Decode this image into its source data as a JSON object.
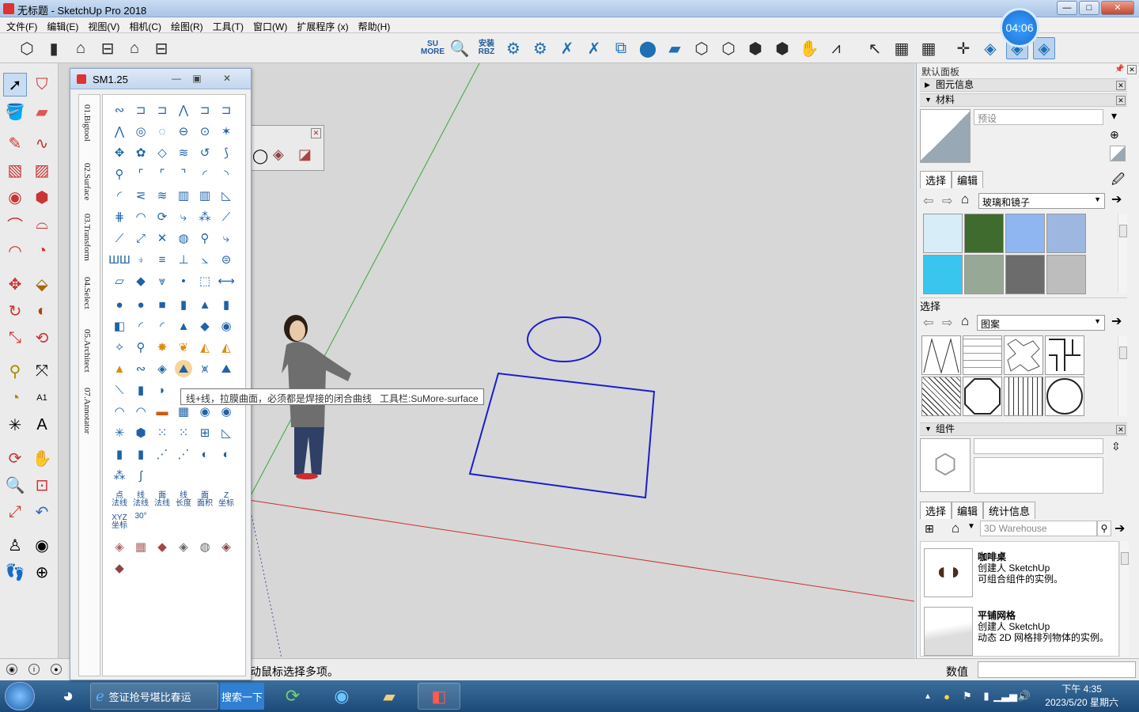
{
  "window": {
    "title": "无标题 - SketchUp Pro 2018",
    "min": "—",
    "max": "□",
    "close": "✕"
  },
  "menu": [
    "文件(F)",
    "编辑(E)",
    "视图(V)",
    "相机(C)",
    "绘图(R)",
    "工具(T)",
    "窗口(W)",
    "扩展程序 (x)",
    "帮助(H)"
  ],
  "toolbar": {
    "su_more": "SU\nMORE",
    "install_rbz": "安装\nRBZ",
    "timer": "04:06"
  },
  "sm_panel": {
    "title": "SM1.25",
    "tabs": [
      "01.Bigtool",
      "02.Surface",
      "03.Transform",
      "04.Select",
      "05.Architect",
      "07.Annotator"
    ],
    "labels": [
      "点\n法线",
      "线\n法线",
      "面\n法线",
      "线\n长度",
      "面\n面积",
      "Z\n坐标",
      "XYZ\n坐标",
      "30°"
    ]
  },
  "tooltip": {
    "text": "线+线，拉膜曲面，必须都是焊接的闭合曲线",
    "toolbar": "工具栏:SuMore-surface"
  },
  "tray": {
    "title": "默认面板",
    "entity_info": "图元信息",
    "materials": {
      "header": "材料",
      "name_placeholder": "预设",
      "tab_select": "选择",
      "tab_edit": "编辑",
      "library": "玻璃和镜子",
      "swatch_colors": [
        "#d7eef8",
        "#3f6b2e",
        "#8fb6f0",
        "#9db7e0",
        "#38c6ef",
        "#98a896",
        "#6c6c6c",
        "#bdbdbd"
      ]
    },
    "patterns": {
      "header": "选择",
      "library": "图案"
    },
    "components": {
      "header": "组件",
      "tab_select": "选择",
      "tab_edit": "编辑",
      "tab_stats": "统计信息",
      "search_placeholder": "3D Warehouse",
      "items": [
        {
          "name": "咖啡桌",
          "author": "创建人 SketchUp",
          "desc": "可组合组件的实例。"
        },
        {
          "name": "平铺网格",
          "author": "创建人 SketchUp",
          "desc": "动态 2D 网格排列物体的实例。"
        }
      ]
    }
  },
  "status": {
    "message": "动鼠标选择多项。",
    "value_label": "数值"
  },
  "taskbar": {
    "ie_label": "签证抢号堪比春运",
    "search_btn": "搜索一下",
    "time": "下午 4:35",
    "date": "2023/5/20 星期六"
  }
}
